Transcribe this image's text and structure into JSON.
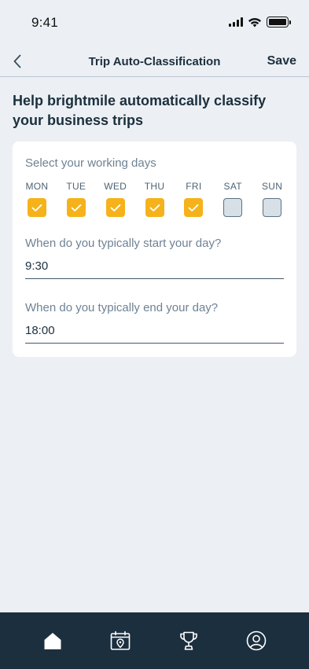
{
  "status_bar": {
    "time": "9:41"
  },
  "nav": {
    "title": "Trip Auto-Classification",
    "save_label": "Save"
  },
  "heading": "Help brightmile automatically classify your business trips",
  "working_days": {
    "label": "Select your working days",
    "days": [
      {
        "label": "MON",
        "checked": true
      },
      {
        "label": "TUE",
        "checked": true
      },
      {
        "label": "WED",
        "checked": true
      },
      {
        "label": "THU",
        "checked": true
      },
      {
        "label": "FRI",
        "checked": true
      },
      {
        "label": "SAT",
        "checked": false
      },
      {
        "label": "SUN",
        "checked": false
      }
    ]
  },
  "start_day": {
    "label": "When do you typically start your day?",
    "value": "9:30"
  },
  "end_day": {
    "label": "When do you typically end your day?",
    "value": "18:00"
  },
  "colors": {
    "accent": "#f5b21a",
    "tab_bar": "#1c2f3e",
    "background": "#ecf0f4"
  },
  "tab_bar": {
    "tabs": [
      {
        "icon": "home-icon",
        "active": true
      },
      {
        "icon": "calendar-pin-icon",
        "active": false
      },
      {
        "icon": "trophy-icon",
        "active": false
      },
      {
        "icon": "profile-icon",
        "active": false
      }
    ]
  }
}
